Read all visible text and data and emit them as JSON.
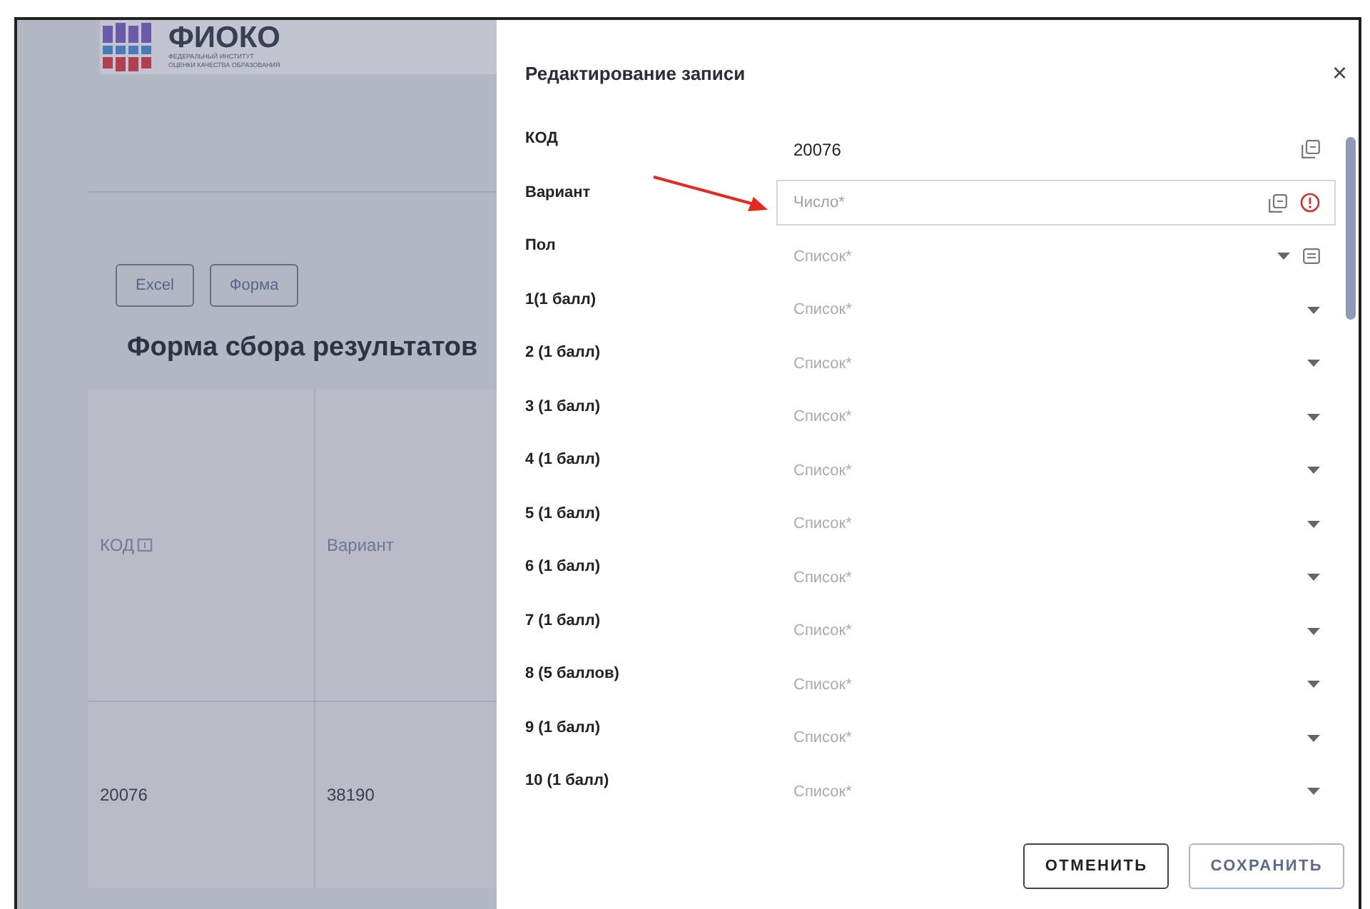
{
  "logo": {
    "name": "ФИОКО",
    "subtitle_lines": [
      "ФЕДЕРАЛЬНЫЙ ИНСТИТУТ",
      "ОЦЕНКИ КАЧЕСТВА ОБРАЗОВАНИЯ"
    ]
  },
  "toolbar_buttons": [
    "Excel",
    "Форма"
  ],
  "page_title": "Форма сбора результатов",
  "table": {
    "columns": [
      {
        "label": "КОД",
        "has_icon": true
      },
      {
        "label": "Вариант",
        "has_icon": false
      }
    ],
    "rows": [
      [
        "20076",
        "38190"
      ]
    ]
  },
  "dialog": {
    "title": "Редактирование записи",
    "close": "×",
    "fields": [
      {
        "label": "КОД",
        "kind": "readonly",
        "value": "20076",
        "error": false,
        "has_note": false
      },
      {
        "label": "Вариант",
        "kind": "number",
        "placeholder": "Число*",
        "error": true,
        "has_note": false
      },
      {
        "label": "Пол",
        "kind": "list",
        "placeholder": "Список*",
        "error": false,
        "has_note": true
      },
      {
        "label": "1(1 балл)",
        "kind": "list",
        "placeholder": "Список*",
        "error": false,
        "has_note": false
      },
      {
        "label": "2 (1 балл)",
        "kind": "list",
        "placeholder": "Список*",
        "error": false,
        "has_note": false
      },
      {
        "label": "3 (1 балл)",
        "kind": "list",
        "placeholder": "Список*",
        "error": false,
        "has_note": false
      },
      {
        "label": "4 (1 балл)",
        "kind": "list",
        "placeholder": "Список*",
        "error": false,
        "has_note": false
      },
      {
        "label": "5 (1 балл)",
        "kind": "list",
        "placeholder": "Список*",
        "error": false,
        "has_note": false
      },
      {
        "label": "6 (1 балл)",
        "kind": "list",
        "placeholder": "Список*",
        "error": false,
        "has_note": false
      },
      {
        "label": "7 (1 балл)",
        "kind": "list",
        "placeholder": "Список*",
        "error": false,
        "has_note": false
      },
      {
        "label": "8 (5 баллов)",
        "kind": "list",
        "placeholder": "Список*",
        "error": false,
        "has_note": false
      },
      {
        "label": "9 (1 балл)",
        "kind": "list",
        "placeholder": "Список*",
        "error": false,
        "has_note": false
      },
      {
        "label": "10 (1 балл)",
        "kind": "list",
        "placeholder": "Список*",
        "error": false,
        "has_note": false
      }
    ],
    "buttons": [
      {
        "label": "ОТМЕНИТЬ",
        "kind": "secondary"
      },
      {
        "label": "СОХРАНИТЬ",
        "kind": "primary"
      }
    ]
  }
}
